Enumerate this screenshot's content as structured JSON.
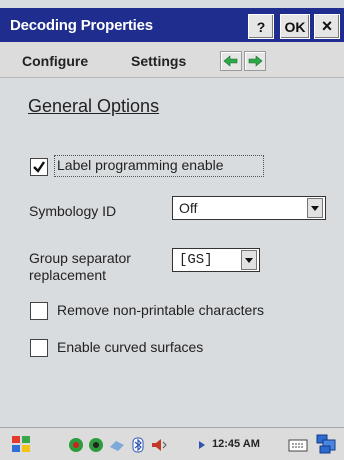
{
  "window": {
    "title": "Decoding Properties",
    "help_label": "?",
    "ok_label": "OK",
    "close_label": "×"
  },
  "menu": {
    "configure": "Configure",
    "settings": "Settings"
  },
  "content": {
    "heading": "General Options",
    "label_programming": {
      "label": "Label programming enable",
      "checked": true
    },
    "symbology_id": {
      "label": "Symbology ID",
      "value": "Off"
    },
    "group_separator": {
      "label_line1": "Group separator",
      "label_line2": "replacement",
      "value": "[GS]"
    },
    "remove_nonprintable": {
      "label": "Remove non-printable characters",
      "checked": false
    },
    "curved_surfaces": {
      "label": "Enable curved surfaces",
      "checked": false
    }
  },
  "taskbar": {
    "time": "12:45 AM"
  },
  "colors": {
    "titlebar": "#1f2d8f",
    "background": "#d9dcdf",
    "arrow_green": "#2fa84a"
  }
}
